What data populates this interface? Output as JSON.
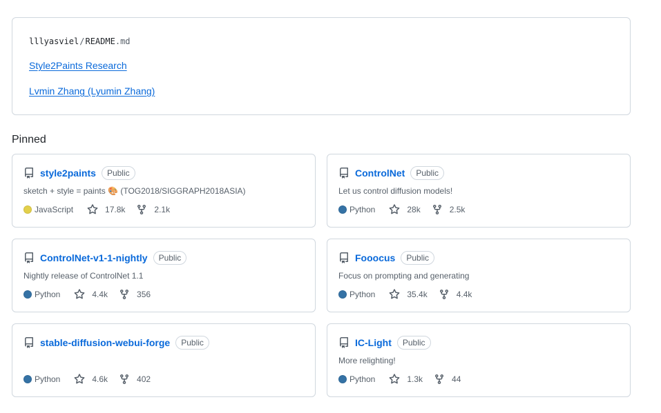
{
  "readme": {
    "user": "lllyasviel",
    "separator": "/",
    "file_base": "README",
    "file_ext": ".md",
    "links": [
      "Style2Paints Research",
      "Lvmin Zhang (Lyumin Zhang)"
    ]
  },
  "pinned": {
    "title": "Pinned",
    "repos": [
      {
        "name": "style2paints",
        "visibility": "Public",
        "description": "sketch + style = paints 🎨 (TOG2018/SIGGRAPH2018ASIA)",
        "language": "JavaScript",
        "language_color": "#e3d04b",
        "stars": "17.8k",
        "forks": "2.1k"
      },
      {
        "name": "ControlNet",
        "visibility": "Public",
        "description": "Let us control diffusion models!",
        "language": "Python",
        "language_color": "#3572A5",
        "stars": "28k",
        "forks": "2.5k"
      },
      {
        "name": "ControlNet-v1-1-nightly",
        "visibility": "Public",
        "description": "Nightly release of ControlNet 1.1",
        "language": "Python",
        "language_color": "#3572A5",
        "stars": "4.4k",
        "forks": "356"
      },
      {
        "name": "Fooocus",
        "visibility": "Public",
        "description": "Focus on prompting and generating",
        "language": "Python",
        "language_color": "#3572A5",
        "stars": "35.4k",
        "forks": "4.4k"
      },
      {
        "name": "stable-diffusion-webui-forge",
        "visibility": "Public",
        "description": "",
        "language": "Python",
        "language_color": "#3572A5",
        "stars": "4.6k",
        "forks": "402"
      },
      {
        "name": "IC-Light",
        "visibility": "Public",
        "description": "More relighting!",
        "language": "Python",
        "language_color": "#3572A5",
        "stars": "1.3k",
        "forks": "44"
      }
    ]
  },
  "icons": {
    "repo": "repo-icon",
    "star": "star-icon",
    "fork": "fork-icon"
  }
}
